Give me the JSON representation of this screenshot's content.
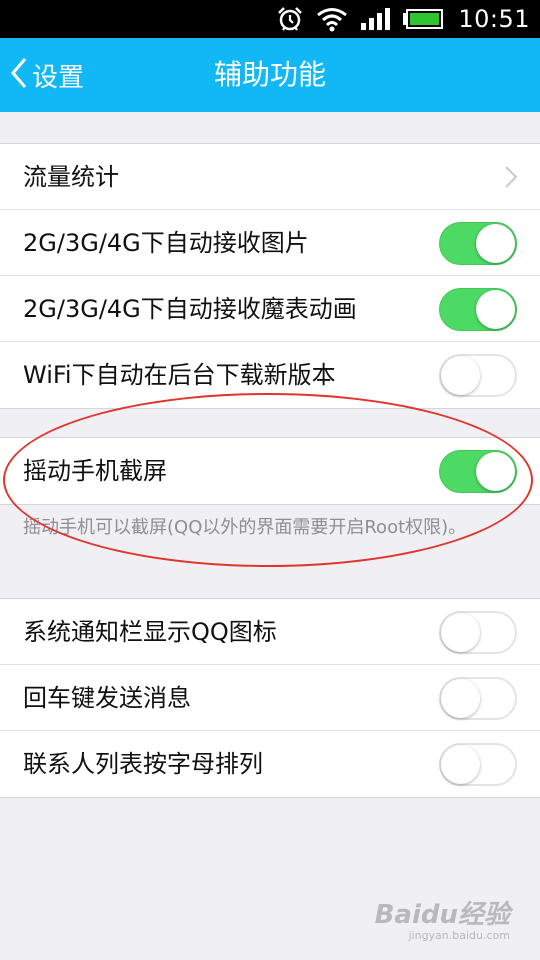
{
  "status_bar": {
    "time": "10:51",
    "icons": [
      "alarm-icon",
      "wifi-icon",
      "signal-icon",
      "battery-icon"
    ],
    "battery_color": "#2fc52f"
  },
  "nav": {
    "back_label": "设置",
    "title": "辅助功能",
    "color": "#12b7f5"
  },
  "groups": {
    "first": [
      {
        "label": "流量统计",
        "control": "chevron"
      },
      {
        "label": "2G/3G/4G下自动接收图片",
        "control": "toggle",
        "on": true
      },
      {
        "label": "2G/3G/4G下自动接收魔表动画",
        "control": "toggle",
        "on": true
      },
      {
        "label": "WiFi下自动在后台下载新版本",
        "control": "toggle",
        "on": false
      }
    ],
    "second": [
      {
        "label": "摇动手机截屏",
        "control": "toggle",
        "on": true
      }
    ],
    "second_hint": "摇动手机可以截屏(QQ以外的界面需要开启Root权限)。",
    "third": [
      {
        "label": "系统通知栏显示QQ图标",
        "control": "toggle",
        "on": false
      },
      {
        "label": "回车键发送消息",
        "control": "toggle",
        "on": false
      },
      {
        "label": "联系人列表按字母排列",
        "control": "toggle",
        "on": false
      }
    ]
  },
  "toggle_on_color": "#4cd964",
  "annotation_color": "#e0342c",
  "watermark": {
    "main": "Baidu经验",
    "sub": "jingyan.baidu.com"
  }
}
